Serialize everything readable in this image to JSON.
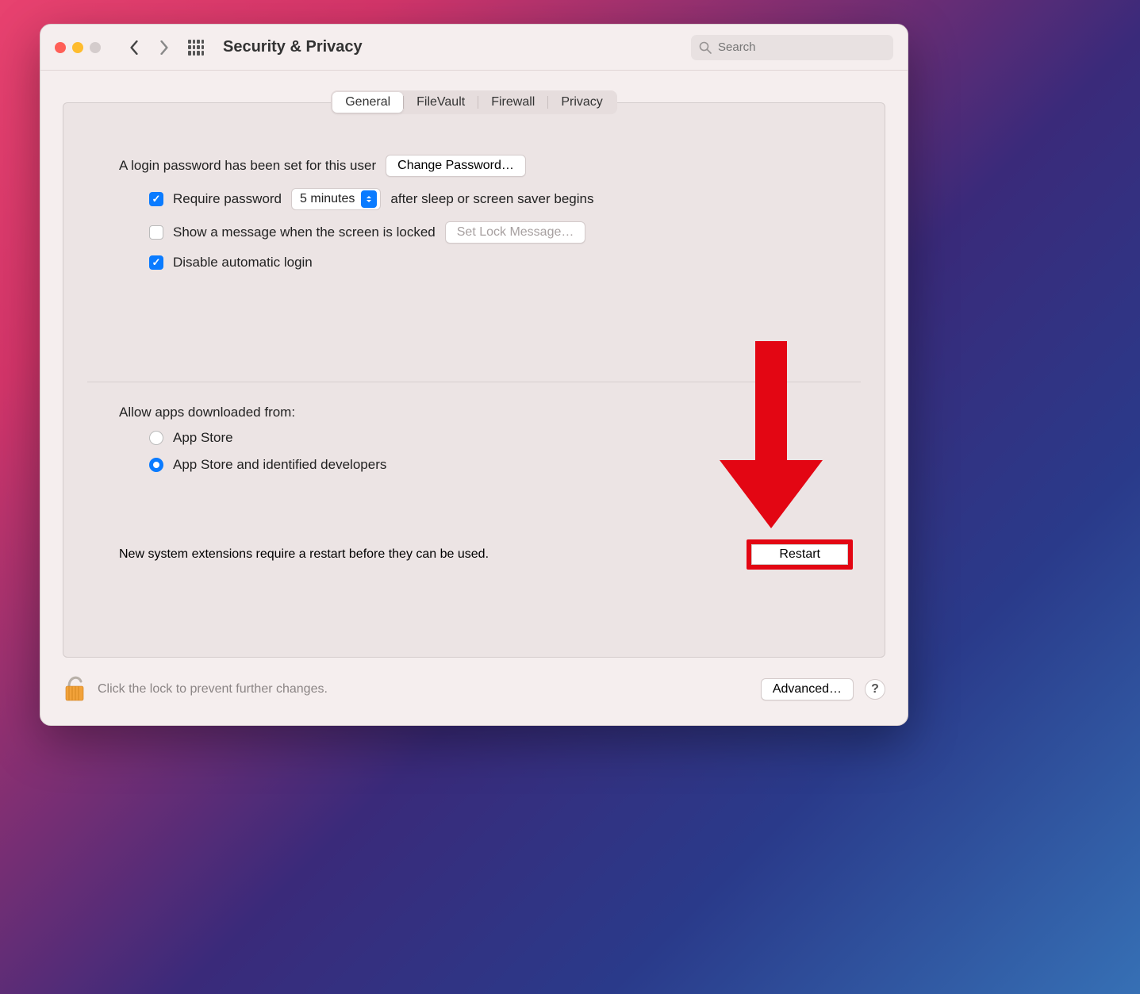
{
  "window": {
    "title": "Security & Privacy",
    "search_placeholder": "Search"
  },
  "tabs": [
    "General",
    "FileVault",
    "Firewall",
    "Privacy"
  ],
  "active_tab_index": 0,
  "login": {
    "password_set_text": "A login password has been set for this user",
    "change_password_btn": "Change Password…",
    "require_password": {
      "label": "Require password",
      "checked": true,
      "delay_value": "5 minutes",
      "suffix": "after sleep or screen saver begins"
    },
    "show_message": {
      "label": "Show a message when the screen is locked",
      "checked": false,
      "set_message_btn": "Set Lock Message…"
    },
    "disable_auto_login": {
      "label": "Disable automatic login",
      "checked": true
    }
  },
  "download": {
    "heading": "Allow apps downloaded from:",
    "options": [
      {
        "label": "App Store",
        "selected": false
      },
      {
        "label": "App Store and identified developers",
        "selected": true
      }
    ]
  },
  "restart": {
    "message": "New system extensions require a restart before they can be used.",
    "button": "Restart"
  },
  "footer": {
    "lock_text": "Click the lock to prevent further changes.",
    "advanced_btn": "Advanced…",
    "help": "?"
  },
  "annotation": {
    "arrow_color": "#e30613"
  }
}
